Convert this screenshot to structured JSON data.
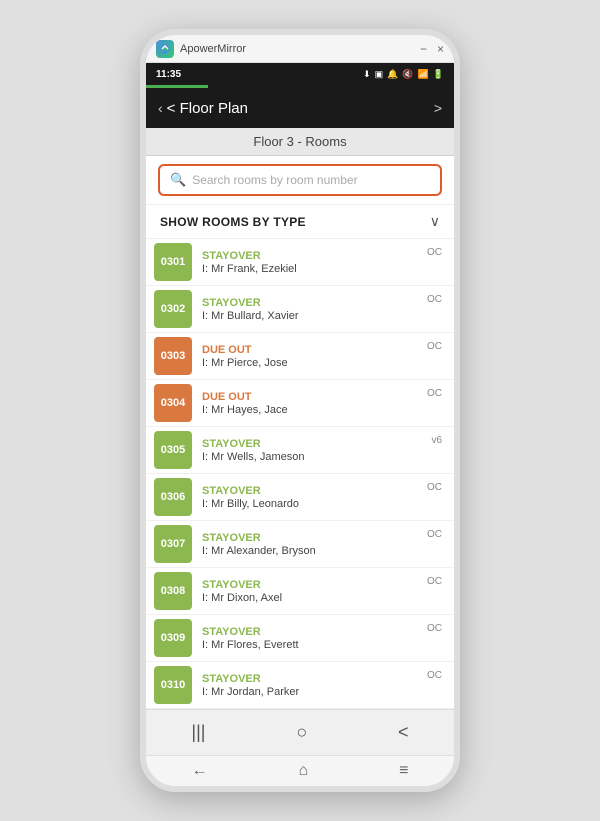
{
  "appTitleBar": {
    "logoAlt": "ApowerMirror logo",
    "appName": "ApowerMirror",
    "minimizeLabel": "−",
    "closeLabel": "×"
  },
  "statusBar": {
    "time": "11:35",
    "icons": [
      "↓",
      "📷",
      "🔔",
      "🔇",
      "📶",
      "🔋"
    ]
  },
  "topNav": {
    "backLabel": "< Floor Plan",
    "chevronRight": ">"
  },
  "sectionHeader": {
    "title": "Floor 3 - Rooms"
  },
  "searchBar": {
    "placeholder": "Search rooms by room number"
  },
  "filterRow": {
    "label": "SHOW ROOMS BY TYPE",
    "chevron": "∨"
  },
  "rooms": [
    {
      "number": "0301",
      "statusLabel": "STAYOVER",
      "statusType": "stayover",
      "guest": "I: Mr Frank, Ezekiel",
      "code": "OC",
      "badgeType": "green"
    },
    {
      "number": "0302",
      "statusLabel": "STAYOVER",
      "statusType": "stayover",
      "guest": "I: Mr Bullard, Xavier",
      "code": "OC",
      "badgeType": "green"
    },
    {
      "number": "0303",
      "statusLabel": "DUE OUT",
      "statusType": "dueout",
      "guest": "I: Mr Pierce, Jose",
      "code": "OC",
      "badgeType": "orange"
    },
    {
      "number": "0304",
      "statusLabel": "DUE OUT",
      "statusType": "dueout",
      "guest": "I: Mr Hayes, Jace",
      "code": "OC",
      "badgeType": "orange"
    },
    {
      "number": "0305",
      "statusLabel": "STAYOVER",
      "statusType": "stayover",
      "guest": "I: Mr Wells, Jameson",
      "code": "v6",
      "badgeType": "green"
    },
    {
      "number": "0306",
      "statusLabel": "STAYOVER",
      "statusType": "stayover",
      "guest": "I: Mr Billy, Leonardo",
      "code": "OC",
      "badgeType": "green"
    },
    {
      "number": "0307",
      "statusLabel": "STAYOVER",
      "statusType": "stayover",
      "guest": "I: Mr Alexander, Bryson",
      "code": "OC",
      "badgeType": "green"
    },
    {
      "number": "0308",
      "statusLabel": "STAYOVER",
      "statusType": "stayover",
      "guest": "I: Mr Dixon, Axel",
      "code": "OC",
      "badgeType": "green"
    },
    {
      "number": "0309",
      "statusLabel": "STAYOVER",
      "statusType": "stayover",
      "guest": "I: Mr Flores, Everett",
      "code": "OC",
      "badgeType": "green"
    },
    {
      "number": "0310",
      "statusLabel": "STAYOVER",
      "statusType": "stayover",
      "guest": "I: Mr Jordan, Parker",
      "code": "OC",
      "badgeType": "green"
    }
  ],
  "androidNavBar": {
    "recentBtn": "|||",
    "homeBtn": "○",
    "backBtn": "<"
  },
  "pcBottomBar": {
    "backBtn": "←",
    "homeBtn": "⌂",
    "menuBtn": "≡"
  }
}
